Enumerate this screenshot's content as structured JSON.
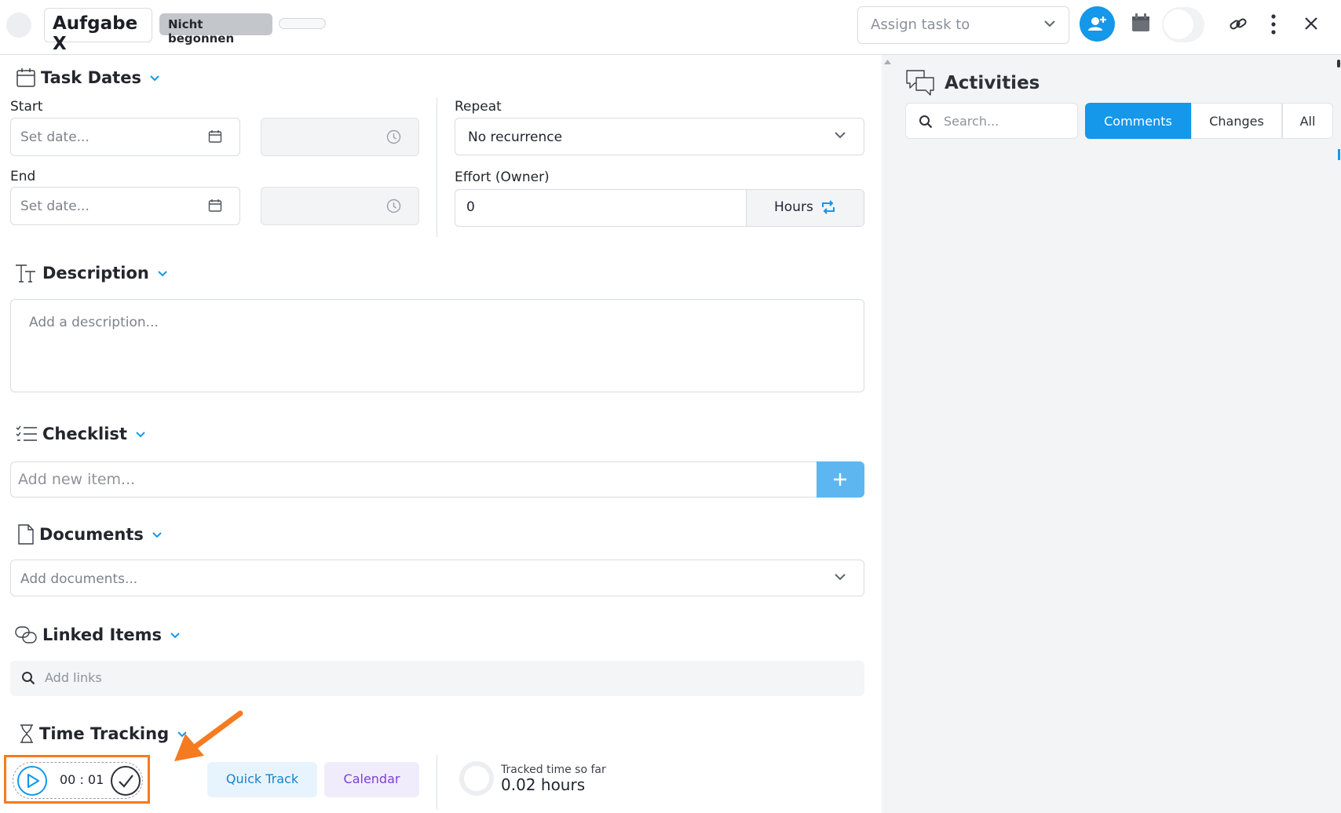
{
  "header": {
    "task_title": "Aufgabe X",
    "status": "Nicht begonnen",
    "assign_placeholder": "Assign task to",
    "icons": [
      "avatar-placeholder",
      "assign-user-icon",
      "calendar-icon",
      "link-icon",
      "more-vertical-icon",
      "close-icon"
    ]
  },
  "task_dates": {
    "heading": "Task Dates",
    "start_label": "Start",
    "start_placeholder": "Set date...",
    "end_label": "End",
    "end_placeholder": "Set date...",
    "repeat_label": "Repeat",
    "repeat_value": "No recurrence",
    "effort_label": "Effort (Owner)",
    "effort_value": "0",
    "effort_unit": "Hours"
  },
  "description": {
    "heading": "Description",
    "placeholder": "Add a description..."
  },
  "checklist": {
    "heading": "Checklist",
    "placeholder": "Add new item..."
  },
  "documents": {
    "heading": "Documents",
    "placeholder": "Add documents..."
  },
  "linked_items": {
    "heading": "Linked Items",
    "placeholder": "Add links"
  },
  "time_tracking": {
    "heading": "Time Tracking",
    "timer": "00 : 01",
    "quick_track": "Quick Track",
    "calendar": "Calendar",
    "tracked_label": "Tracked time so far",
    "tracked_value": "0.02 hours"
  },
  "activities": {
    "heading": "Activities",
    "search_placeholder": "Search...",
    "tabs": [
      {
        "label": "Comments",
        "active": true
      },
      {
        "label": "Changes",
        "active": false
      },
      {
        "label": "All",
        "active": false
      }
    ]
  },
  "colors": {
    "accent": "#1597ea",
    "highlight": "#f47b20",
    "quick_track_text": "#1783cc",
    "calendar_text": "#7c3fd6"
  }
}
